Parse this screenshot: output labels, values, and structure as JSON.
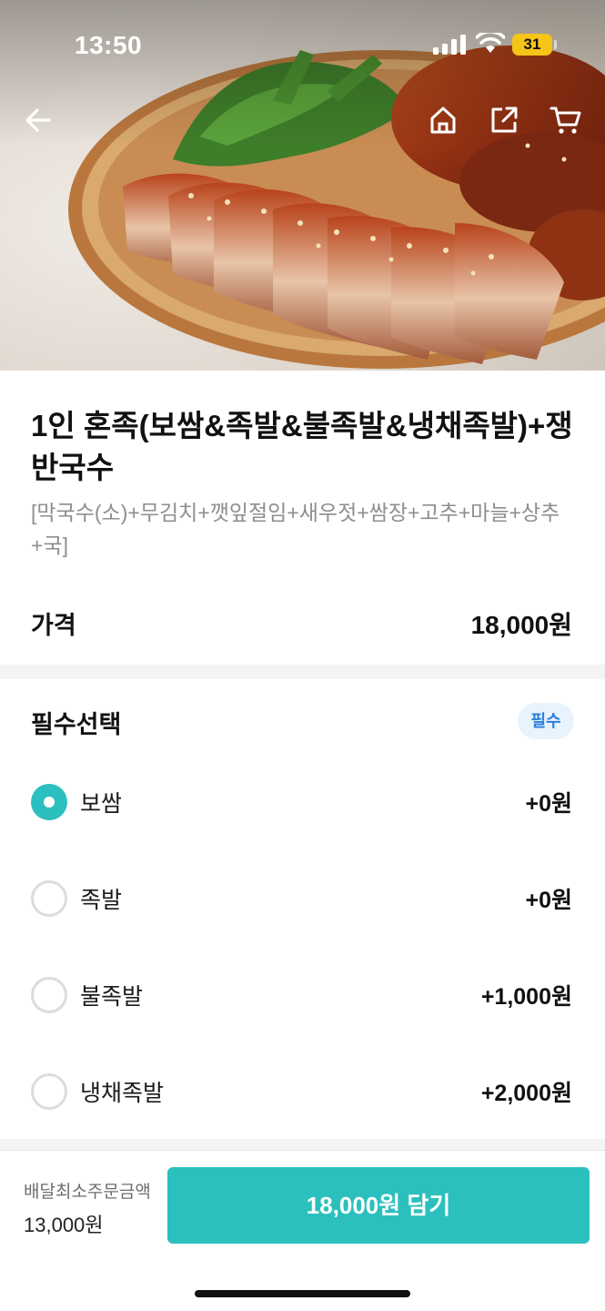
{
  "status_bar": {
    "time": "13:50",
    "battery": "31"
  },
  "header": {
    "back_icon": "arrow-left-icon",
    "home_icon": "home-icon",
    "share_icon": "share-icon",
    "cart_icon": "cart-icon"
  },
  "product": {
    "title": "1인 혼족(보쌈&족발&불족발&냉채족발)+쟁반국수",
    "description": "[막국수(소)+무김치+깻잎절임+새우젓+쌈장+고추+마늘+상추+국]",
    "price_label": "가격",
    "price_value": "18,000원"
  },
  "options": {
    "heading": "필수선택",
    "badge": "필수",
    "items": [
      {
        "name": "보쌈",
        "price": "+0원",
        "selected": true
      },
      {
        "name": "족발",
        "price": "+0원",
        "selected": false
      },
      {
        "name": "불족발",
        "price": "+1,000원",
        "selected": false
      },
      {
        "name": "냉채족발",
        "price": "+2,000원",
        "selected": false
      }
    ]
  },
  "bottom": {
    "min_order_label": "배달최소주문금액",
    "min_order_value": "13,000원",
    "add_button": "18,000원 담기"
  },
  "colors": {
    "accent": "#2bc0bd",
    "badge_text": "#2d7fd8",
    "badge_bg": "#e8f3fd"
  }
}
